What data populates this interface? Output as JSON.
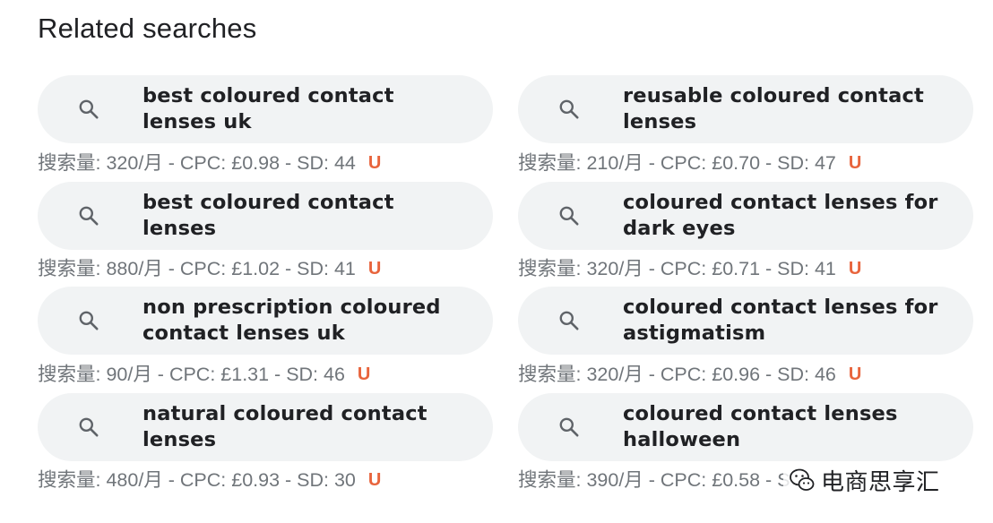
{
  "section": {
    "title": "Related searches"
  },
  "items": [
    {
      "query": "best coloured contact lenses uk",
      "metrics": "搜索量: 320/月 - CPC: £0.98 - SD: 44",
      "badge": "U"
    },
    {
      "query": "reusable coloured contact lenses",
      "metrics": "搜索量: 210/月 - CPC: £0.70 - SD: 47",
      "badge": "U"
    },
    {
      "query": "best coloured contact lenses",
      "metrics": "搜索量: 880/月 - CPC: £1.02 - SD: 41",
      "badge": "U"
    },
    {
      "query": "coloured contact lenses for dark eyes",
      "metrics": "搜索量: 320/月 - CPC: £0.71 - SD: 41",
      "badge": "U"
    },
    {
      "query": "non prescription coloured contact lenses uk",
      "metrics": "搜索量: 90/月 - CPC: £1.31 - SD: 46",
      "badge": "U"
    },
    {
      "query": "coloured contact lenses for astigmatism",
      "metrics": "搜索量: 320/月 - CPC: £0.96 - SD: 46",
      "badge": "U"
    },
    {
      "query": "natural coloured contact lenses",
      "metrics": "搜索量: 480/月 - CPC: £0.93 - SD: 30",
      "badge": "U"
    },
    {
      "query": "coloured contact lenses halloween",
      "metrics": "搜索量: 390/月 - CPC: £0.58 - S",
      "badge": ""
    }
  ],
  "icons": {
    "search": "search-icon",
    "watermark": "wechat-logo-icon"
  },
  "colors": {
    "chip_background": "#f1f3f4",
    "query_text": "#202124",
    "metrics_text": "#70757a",
    "badge": "#e8643c"
  },
  "watermark": {
    "text": "电商思享汇"
  }
}
